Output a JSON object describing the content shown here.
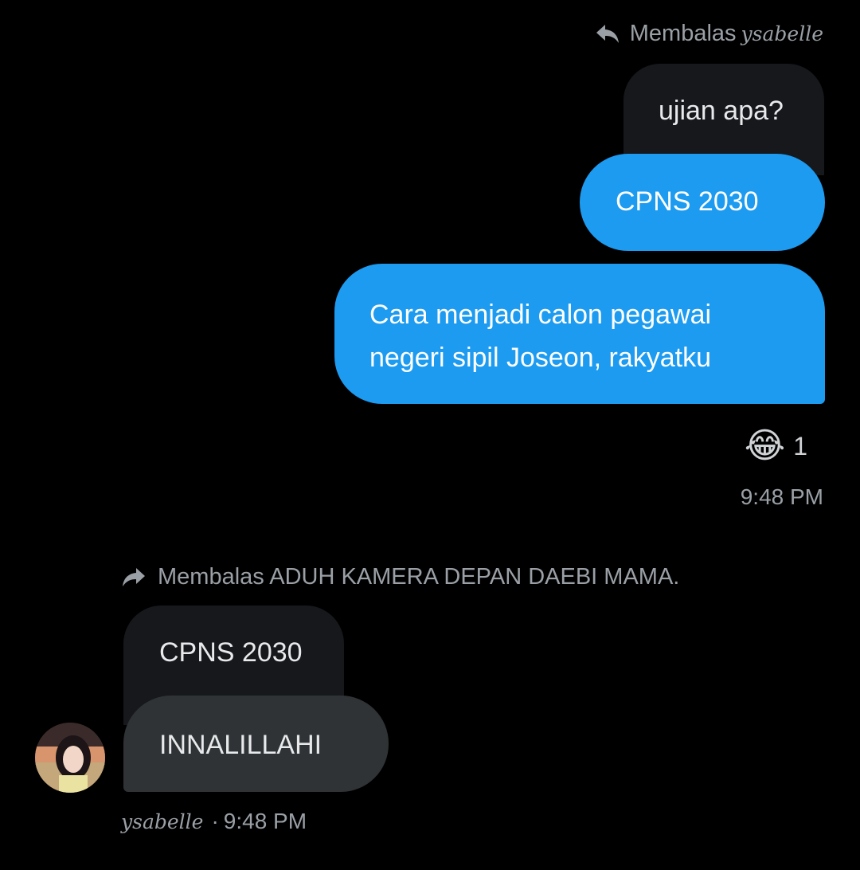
{
  "outgoing": {
    "reply_to": {
      "prefix": "Membalas",
      "name": "ysabelle"
    },
    "quoted_text": "ujian apa?",
    "messages": [
      {
        "text": "CPNS 2030"
      },
      {
        "text_line1": "Cara menjadi calon pegawai",
        "text_line2": "negeri sipil Joseon, rakyatku"
      }
    ],
    "reaction": {
      "emoji": "😂",
      "count": "1"
    },
    "timestamp": "9:48 PM"
  },
  "incoming": {
    "reply_to": {
      "text": "Membalas ADUH KAMERA DEPAN DAEBI MAMA."
    },
    "quoted_text": "CPNS 2030",
    "message": "INNALILLAHI",
    "sender": "ysabelle",
    "separator": "·",
    "timestamp": "9:48 PM"
  },
  "colors": {
    "background": "#000000",
    "outgoing_bubble": "#1d9bf0",
    "incoming_bubble": "#2f3336",
    "quoted_bubble": "#16181c",
    "muted_text": "#9aa0a6"
  },
  "icons": {
    "reply_outgoing": "reply-arrow-icon",
    "reply_incoming": "forward-arrow-icon"
  }
}
